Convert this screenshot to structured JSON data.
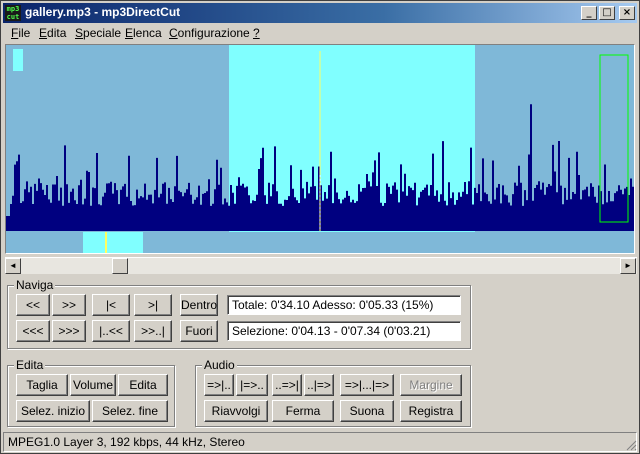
{
  "window": {
    "title": "gallery.mp3 - mp3DirectCut",
    "icon_text": "mp3 cut",
    "controls": {
      "minimize": "_",
      "maximize": "□",
      "close": "×"
    }
  },
  "menu": [
    {
      "label": "File",
      "accel": "F",
      "rest": "ile"
    },
    {
      "label": "Edita",
      "accel": "E",
      "rest": "dita"
    },
    {
      "label": "Speciale",
      "accel": "S",
      "rest": "peciale"
    },
    {
      "label": "Elenca",
      "accel": "E",
      "rest": "lenca"
    },
    {
      "label": "Configurazione",
      "accel": "C",
      "rest": "onfigurazione"
    },
    {
      "label": "?",
      "accel": "?",
      "rest": ""
    }
  ],
  "colors": {
    "wave_bg": "#7fb8d8",
    "selection": "#80ffff",
    "wave_fill": "#000080",
    "cursor": "#ffff60",
    "frame": "#00ff00"
  },
  "scrollbar": {
    "left_arrow": "◄",
    "right_arrow": "►"
  },
  "naviga": {
    "title": "Naviga",
    "buttons_row1": [
      "<<",
      ">>",
      "|<",
      ">|"
    ],
    "buttons_row2": [
      "<<<",
      ">>>",
      "|..<<",
      ">>..|"
    ],
    "dentro": "Dentro",
    "fuori": "Fuori",
    "totale": "Totale: 0'34.10   Adesso: 0'05.33  (15%)",
    "selezione": "Selezione: 0'04.13 - 0'07.34 (0'03.21)"
  },
  "edita": {
    "title": "Edita",
    "taglia": "Taglia",
    "volume": "Volume",
    "edita": "Edita",
    "selez_inizio": "Selez. inizio",
    "selez_fine": "Selez. fine"
  },
  "audio": {
    "title": "Audio",
    "buttons_row1": [
      "=>|..",
      "|=>..",
      "..=>|",
      "..|=>",
      "=>|...|=>"
    ],
    "margine": "Margine",
    "riavvolgi": "Riavvolgi",
    "ferma": "Ferma",
    "suona": "Suona",
    "registra": "Registra"
  },
  "status": "MPEG1.0 Layer 3, 192 kbps, 44 kHz, Stereo"
}
